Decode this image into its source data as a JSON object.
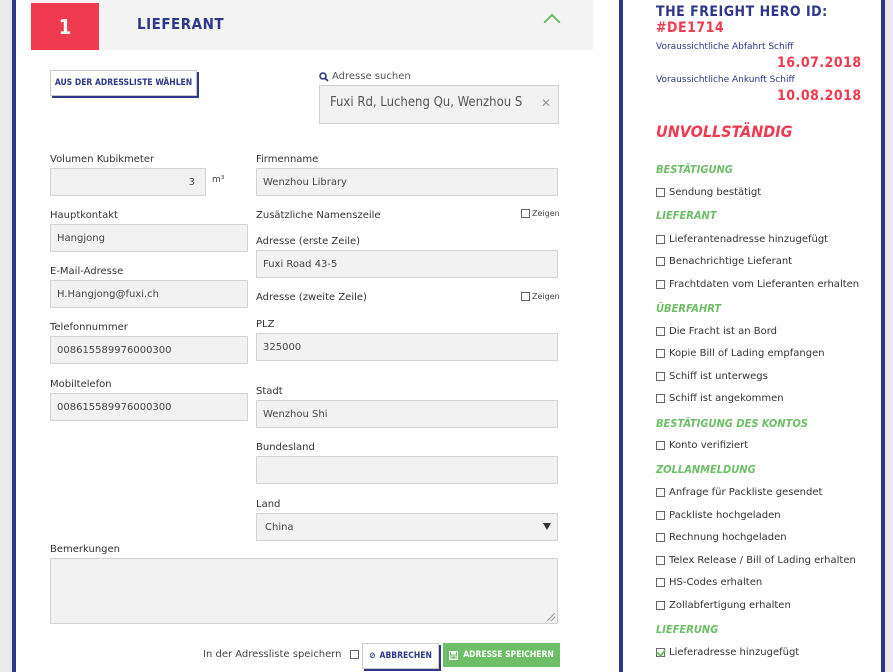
{
  "step": {
    "number": "1",
    "title": "LIEFERANT"
  },
  "address_book_button": "AUS DER ADRESSLISTE WÄHLEN",
  "search": {
    "label": "Adresse suchen",
    "value": "Fuxi Rd, Lucheng Qu, Wenzhou S"
  },
  "form": {
    "volume": {
      "label": "Volumen Kubikmeter",
      "value": "3",
      "unit": "m³"
    },
    "company": {
      "label": "Firmenname",
      "value": "Wenzhou Library"
    },
    "contact": {
      "label": "Hauptkontakt",
      "value": "Hangjong"
    },
    "extra_name": {
      "label": "Zusätzliche Namenszeile",
      "show": "Zeigen"
    },
    "address1": {
      "label": "Adresse (erste Zeile)",
      "value": "Fuxi Road 43-5"
    },
    "email": {
      "label": "E-Mail-Adresse",
      "value": "H.Hangjong@fuxi.ch"
    },
    "address2": {
      "label": "Adresse (zweite Zeile)",
      "show": "Zeigen"
    },
    "phone": {
      "label": "Telefonnummer",
      "value": "008615589976000300"
    },
    "zip": {
      "label": "PLZ",
      "value": "325000"
    },
    "mobile": {
      "label": "Mobiltelefon",
      "value": "008615589976000300"
    },
    "city": {
      "label": "Stadt",
      "value": "Wenzhou Shi"
    },
    "state": {
      "label": "Bundesland",
      "value": ""
    },
    "country": {
      "label": "Land",
      "value": "China"
    },
    "notes": {
      "label": "Bemerkungen",
      "value": ""
    }
  },
  "save_in_list_label": "In der Adressliste speichern",
  "cancel_button": "ABBRECHEN",
  "save_button": "ADRESSE SPEICHERN",
  "sidebar": {
    "title": "THE FREIGHT HERO ID:",
    "id": "#DE1714",
    "departure_label": "Voraussichtliche Abfahrt Schiff",
    "departure_date": "16.07.2018",
    "arrival_label": "Voraussichtliche Ankunft Schiff",
    "arrival_date": "10.08.2018",
    "status": "UNVOLLSTÄNDIG",
    "sections": [
      {
        "title": "BESTÄTIGUNG",
        "items": [
          {
            "label": "Sendung bestätigt",
            "checked": false
          }
        ]
      },
      {
        "title": "LIEFERANT",
        "items": [
          {
            "label": "Lieferantenadresse hinzugefügt",
            "checked": false
          },
          {
            "label": "Benachrichtige Lieferant",
            "checked": false
          },
          {
            "label": "Frachtdaten vom Lieferanten erhalten",
            "checked": false
          }
        ]
      },
      {
        "title": "ÜBERFAHRT",
        "items": [
          {
            "label": "Die Fracht ist an Bord",
            "checked": false
          },
          {
            "label": "Kopie Bill of Lading empfangen",
            "checked": false
          },
          {
            "label": "Schiff ist unterwegs",
            "checked": false
          },
          {
            "label": "Schiff ist angekommen",
            "checked": false
          }
        ]
      },
      {
        "title": "BESTÄTIGUNG DES KONTOS",
        "items": [
          {
            "label": "Konto verifiziert",
            "checked": false
          }
        ]
      },
      {
        "title": "ZOLLANMELDUNG",
        "items": [
          {
            "label": "Anfrage für Packliste gesendet",
            "checked": false
          },
          {
            "label": "Packliste hochgeladen",
            "checked": false
          },
          {
            "label": "Rechnung hochgeladen",
            "checked": false
          },
          {
            "label": "Telex Release / Bill of Lading erhalten",
            "checked": false
          },
          {
            "label": "HS-Codes erhalten",
            "checked": false
          },
          {
            "label": "Zollabfertigung erhalten",
            "checked": false
          }
        ]
      },
      {
        "title": "LIEFERUNG",
        "items": [
          {
            "label": "Lieferadresse hinzugefügt",
            "checked": true
          }
        ]
      }
    ]
  },
  "colors": {
    "navy": "#2e3789",
    "red": "#ef3a50",
    "green": "#6dbf67"
  }
}
